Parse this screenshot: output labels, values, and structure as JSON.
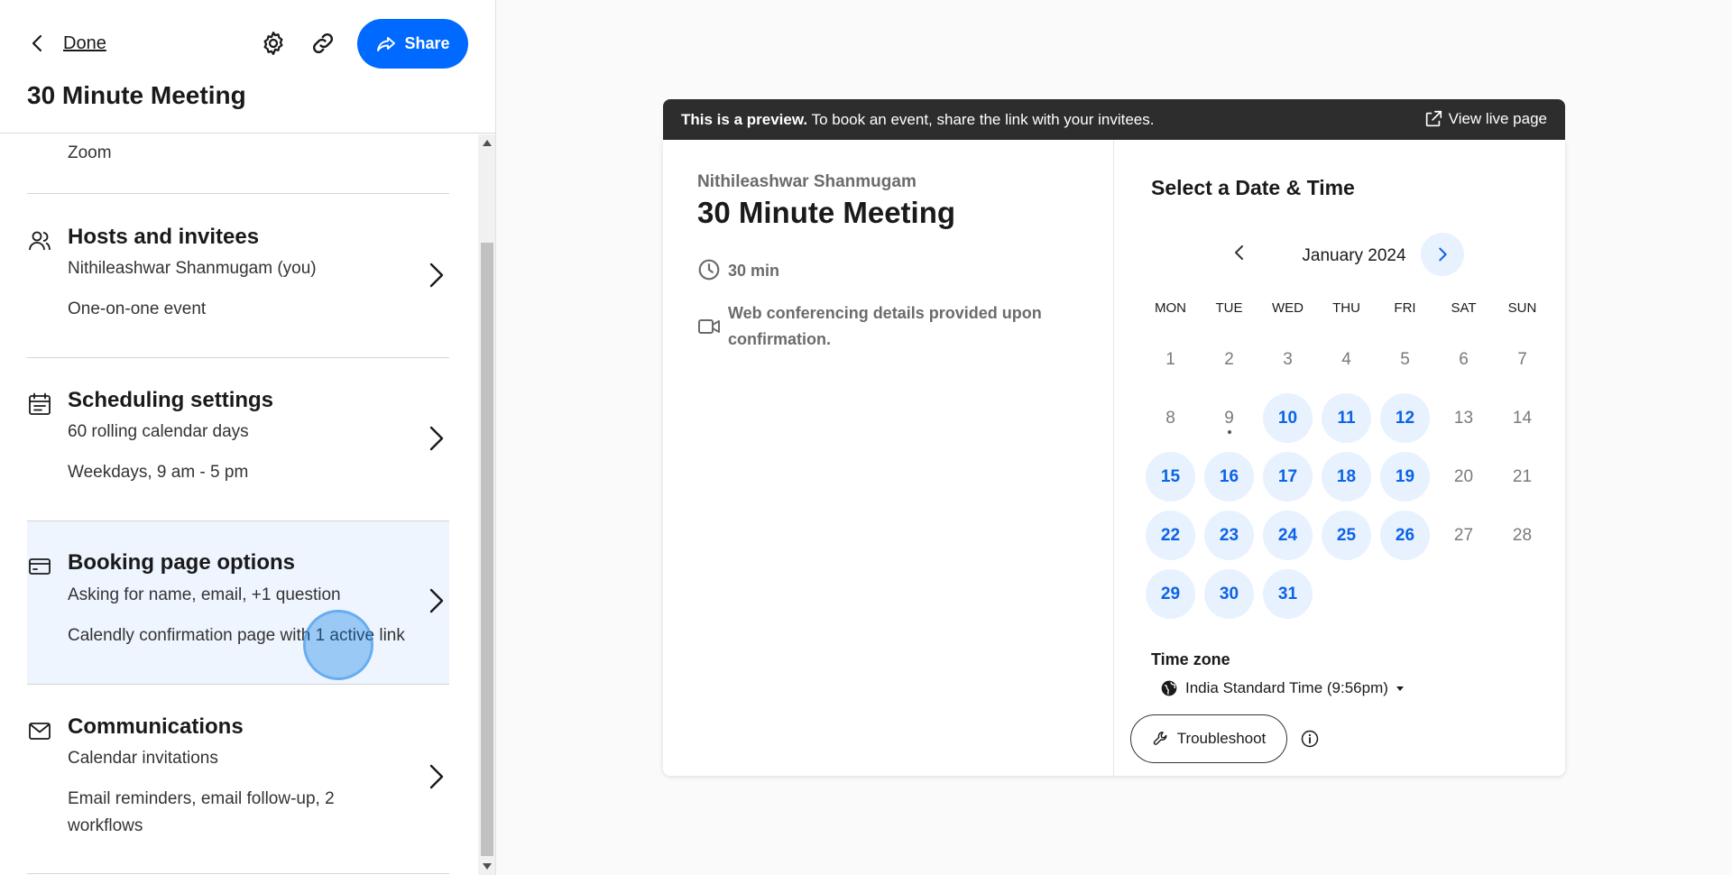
{
  "header": {
    "done_label": "Done",
    "share_label": "Share",
    "event_title": "30 Minute Meeting"
  },
  "location": {
    "value": "Zoom"
  },
  "sections": {
    "hosts": {
      "title": "Hosts and invitees",
      "line1": "Nithileashwar Shanmugam (you)",
      "line2": "One-on-one event"
    },
    "scheduling": {
      "title": "Scheduling settings",
      "line1": "60 rolling calendar days",
      "line2": "Weekdays, 9 am - 5 pm"
    },
    "booking": {
      "title": "Booking page options",
      "line1": "Asking for name, email, +1 question",
      "line2": "Calendly confirmation page with 1 active link"
    },
    "communications": {
      "title": "Communications",
      "line1": "Calendar invitations",
      "line2": "Email reminders, email follow-up, 2 workflows"
    }
  },
  "preview": {
    "banner_bold": "This is a preview.",
    "banner_text": " To book an event, share the link with your invitees.",
    "view_live": "View live page",
    "host_name": "Nithileashwar Shanmugam",
    "title": "30 Minute Meeting",
    "duration": "30 min",
    "conferencing": "Web conferencing details provided upon confirmation.",
    "select_title": "Select a Date & Time",
    "month": "January 2024",
    "weekdays": [
      "MON",
      "TUE",
      "WED",
      "THU",
      "FRI",
      "SAT",
      "SUN"
    ],
    "days": [
      {
        "n": "1",
        "avail": false
      },
      {
        "n": "2",
        "avail": false
      },
      {
        "n": "3",
        "avail": false
      },
      {
        "n": "4",
        "avail": false
      },
      {
        "n": "5",
        "avail": false
      },
      {
        "n": "6",
        "avail": false
      },
      {
        "n": "7",
        "avail": false
      },
      {
        "n": "8",
        "avail": false
      },
      {
        "n": "9",
        "avail": false,
        "today": true
      },
      {
        "n": "10",
        "avail": true
      },
      {
        "n": "11",
        "avail": true
      },
      {
        "n": "12",
        "avail": true
      },
      {
        "n": "13",
        "avail": false
      },
      {
        "n": "14",
        "avail": false
      },
      {
        "n": "15",
        "avail": true
      },
      {
        "n": "16",
        "avail": true
      },
      {
        "n": "17",
        "avail": true
      },
      {
        "n": "18",
        "avail": true
      },
      {
        "n": "19",
        "avail": true
      },
      {
        "n": "20",
        "avail": false
      },
      {
        "n": "21",
        "avail": false
      },
      {
        "n": "22",
        "avail": true
      },
      {
        "n": "23",
        "avail": true
      },
      {
        "n": "24",
        "avail": true
      },
      {
        "n": "25",
        "avail": true
      },
      {
        "n": "26",
        "avail": true
      },
      {
        "n": "27",
        "avail": false
      },
      {
        "n": "28",
        "avail": false
      },
      {
        "n": "29",
        "avail": true
      },
      {
        "n": "30",
        "avail": true
      },
      {
        "n": "31",
        "avail": true
      }
    ],
    "timezone_label": "Time zone",
    "timezone_value": "India Standard Time (9:56pm)",
    "troubleshoot": "Troubleshoot"
  },
  "colors": {
    "accent": "#0069ff",
    "available_day_bg": "#e8f1fe",
    "available_day_text": "#0b63e5",
    "banner_bg": "#2d2d2d"
  }
}
